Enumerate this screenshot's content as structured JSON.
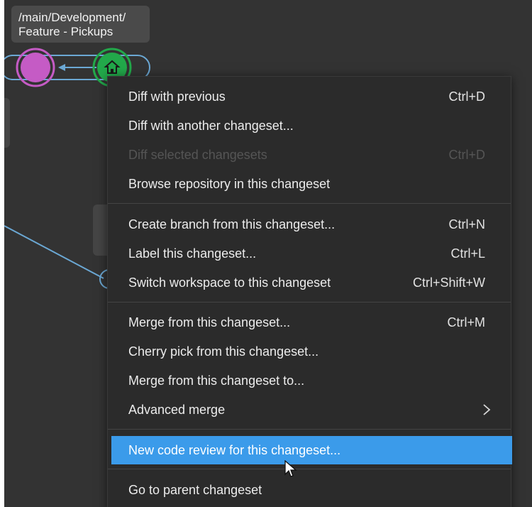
{
  "branch": {
    "path_line1": "/main/Development/",
    "path_line2": "Feature - Pickups"
  },
  "graph": {
    "changeset_colors": [
      "#c55bc5",
      "#22a84a"
    ],
    "link_color": "#6ba8d4",
    "current_icon": "home-icon"
  },
  "menu": {
    "groups": [
      {
        "items": [
          {
            "label": "Diff with previous",
            "shortcut": "Ctrl+D",
            "enabled": true
          },
          {
            "label": "Diff with another changeset...",
            "shortcut": "",
            "enabled": true
          },
          {
            "label": "Diff selected changesets",
            "shortcut": "Ctrl+D",
            "enabled": false
          },
          {
            "label": "Browse repository in this changeset",
            "shortcut": "",
            "enabled": true
          }
        ]
      },
      {
        "items": [
          {
            "label": "Create branch from this changeset...",
            "shortcut": "Ctrl+N",
            "enabled": true
          },
          {
            "label": "Label this changeset...",
            "shortcut": "Ctrl+L",
            "enabled": true
          },
          {
            "label": "Switch workspace to this changeset",
            "shortcut": "Ctrl+Shift+W",
            "enabled": true
          }
        ]
      },
      {
        "items": [
          {
            "label": "Merge from this changeset...",
            "shortcut": "Ctrl+M",
            "enabled": true
          },
          {
            "label": "Cherry pick from this changeset...",
            "shortcut": "",
            "enabled": true
          },
          {
            "label": "Merge from this changeset to...",
            "shortcut": "",
            "enabled": true
          },
          {
            "label": "Advanced merge",
            "shortcut": "",
            "enabled": true,
            "submenu": true,
            "submenu_icon": "chevron-right-icon"
          }
        ]
      },
      {
        "items": [
          {
            "label": "New code review for this changeset...",
            "shortcut": "",
            "enabled": true,
            "highlighted": true,
            "highlight_color": "#3b9bea"
          }
        ]
      },
      {
        "items": [
          {
            "label": "Go to parent changeset",
            "shortcut": "",
            "enabled": true
          }
        ]
      }
    ]
  },
  "cursor": {
    "icon": "mouse-pointer-icon"
  }
}
